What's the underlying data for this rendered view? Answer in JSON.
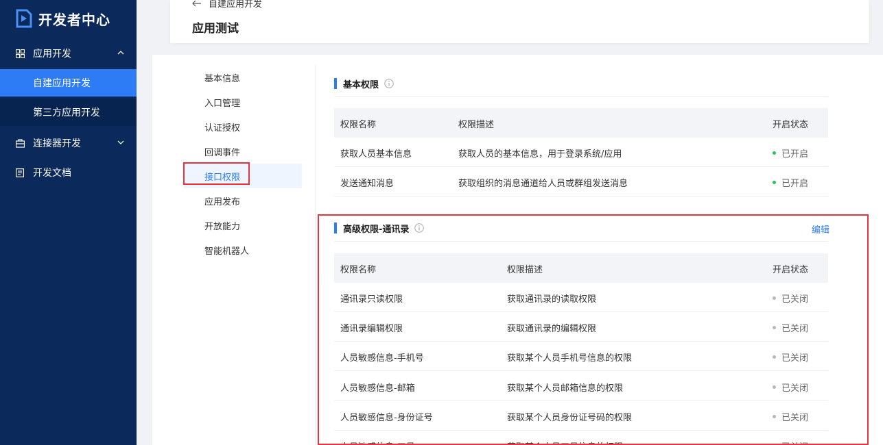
{
  "sidebar": {
    "logo_text": "开发者中心",
    "groups": [
      {
        "label": "应用开发"
      },
      {
        "label": "连接器开发"
      },
      {
        "label": "开发文档"
      }
    ],
    "subs": [
      {
        "label": "自建应用开发"
      },
      {
        "label": "第三方应用开发"
      }
    ]
  },
  "header": {
    "back_label": "自建应用开发",
    "title": "应用测试"
  },
  "leftmenu": {
    "items": [
      {
        "label": "基本信息"
      },
      {
        "label": "入口管理"
      },
      {
        "label": "认证授权"
      },
      {
        "label": "回调事件"
      },
      {
        "label": "接口权限"
      },
      {
        "label": "应用发布"
      },
      {
        "label": "开放能力"
      },
      {
        "label": "智能机器人"
      }
    ]
  },
  "basic": {
    "title": "基本权限",
    "headers": [
      "权限名称",
      "权限描述",
      "开启状态"
    ],
    "rows": [
      {
        "name": "获取人员基本信息",
        "desc": "获取人员的基本信息，用于登录系统/应用",
        "status": "已开启"
      },
      {
        "name": "发送通知消息",
        "desc": "获取组织的消息通道给人员或群组发送消息",
        "status": "已开启"
      }
    ]
  },
  "advanced": {
    "title": "高级权限-通讯录",
    "edit_label": "编辑",
    "headers": [
      "权限名称",
      "权限描述",
      "开启状态"
    ],
    "rows": [
      {
        "name": "通讯录只读权限",
        "desc": "获取通讯录的读取权限",
        "status": "已关闭"
      },
      {
        "name": "通讯录编辑权限",
        "desc": "获取通讯录的编辑权限",
        "status": "已关闭"
      },
      {
        "name": "人员敏感信息-手机号",
        "desc": "获取某个人员手机号信息的权限",
        "status": "已关闭"
      },
      {
        "name": "人员敏感信息-邮箱",
        "desc": "获取某个人员邮箱信息的权限",
        "status": "已关闭"
      },
      {
        "name": "人员敏感信息-身份证号",
        "desc": "获取某个人员身份证号码的权限",
        "status": "已关闭"
      },
      {
        "name": "人员敏感信息-工号",
        "desc": "获取某个人员工号信息的权限",
        "status": "已关闭"
      }
    ]
  },
  "colors": {
    "sidebar_bg": "#0b2a5b",
    "accent": "#2d7cf6",
    "enabled_dot": "#22c55e",
    "disabled_dot": "#b5b8bf",
    "highlight_border": "#e8333d"
  }
}
